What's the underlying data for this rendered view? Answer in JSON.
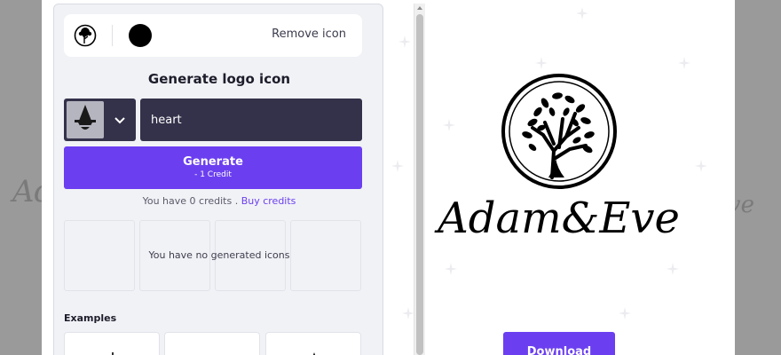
{
  "backdrop": {
    "ghost_text": "Adam&",
    "ghost_right": "ve"
  },
  "icon_row": {
    "remove_label": "Remove icon"
  },
  "generate_section": {
    "title": "Generate logo icon",
    "prompt_value": "heart",
    "button_label": "Generate",
    "button_cost": "- 1 Credit",
    "credits_text": "You have 0 credits . ",
    "buy_link": "Buy credits",
    "empty_text": "You have no generated icons"
  },
  "examples": {
    "title": "Examples"
  },
  "preview": {
    "brand_name": "Adam&Eve",
    "download_label": "Download"
  },
  "colors": {
    "accent": "#6b3ff0",
    "dark_input": "#34324a",
    "panel_bg": "#f1f2f6"
  }
}
